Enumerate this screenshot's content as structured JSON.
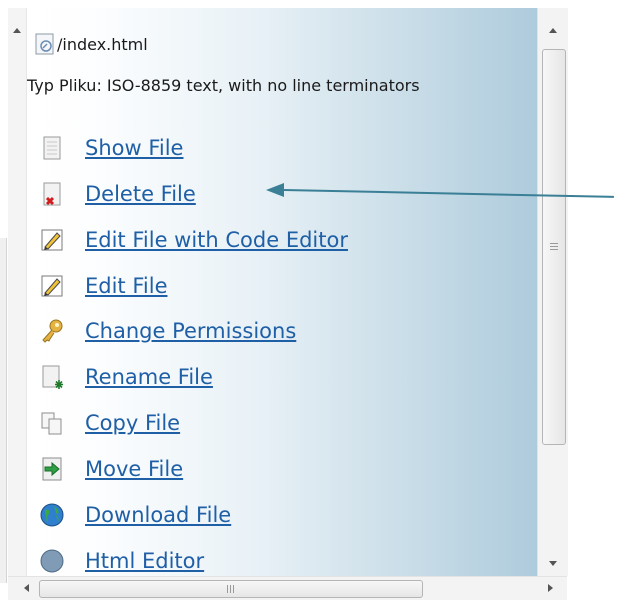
{
  "file": {
    "path": "/index.html",
    "icon": "html-file-icon",
    "type_line": "Typ Pliku: ISO-8859 text, with no line terminators"
  },
  "actions": [
    {
      "label": "Show File",
      "icon": "document-icon"
    },
    {
      "label": "Delete File",
      "icon": "delete-file-icon"
    },
    {
      "label": "Edit File with Code Editor",
      "icon": "pencil-icon"
    },
    {
      "label": "Edit File",
      "icon": "pencil-icon"
    },
    {
      "label": "Change Permissions",
      "icon": "key-icon"
    },
    {
      "label": "Rename File",
      "icon": "rename-file-icon"
    },
    {
      "label": "Copy File",
      "icon": "copy-icon"
    },
    {
      "label": "Move File",
      "icon": "move-file-icon"
    },
    {
      "label": "Download File",
      "icon": "globe-icon"
    },
    {
      "label": "Html Editor",
      "icon": "globe-icon"
    }
  ],
  "colors": {
    "link": "#1f5fa6",
    "pointer": "#3a7f96"
  }
}
